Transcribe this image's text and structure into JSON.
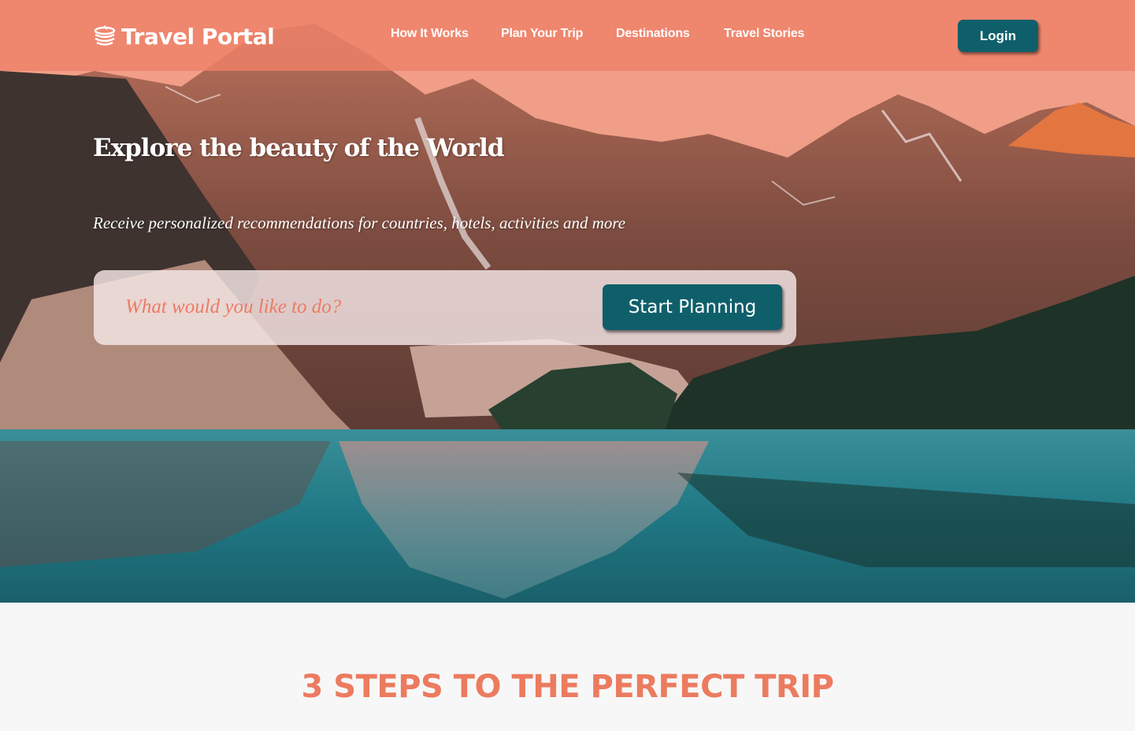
{
  "brand": {
    "name": "Travel Portal",
    "icon": "coin-stack-icon"
  },
  "nav": {
    "items": [
      {
        "label": "How It Works"
      },
      {
        "label": "Plan Your Trip"
      },
      {
        "label": "Destinations"
      },
      {
        "label": "Travel Stories"
      }
    ],
    "login_label": "Login"
  },
  "hero": {
    "title": "Explore the beauty of the World",
    "subtitle": "Receive personalized recommendations for countries, hotels, activities and more",
    "search": {
      "placeholder": "What would you like to do?",
      "value": ""
    },
    "cta_label": "Start Planning"
  },
  "steps": {
    "title": "3 STEPS TO THE PERFECT TRIP"
  },
  "colors": {
    "accent": "#ec7b5f",
    "button": "#0f5f6b",
    "nav_bg": "#ee8068"
  }
}
